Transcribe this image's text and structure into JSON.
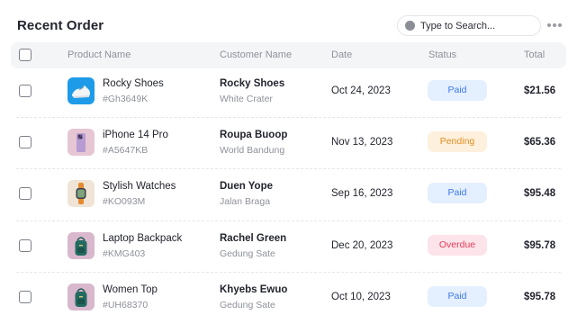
{
  "header": {
    "title": "Recent Order",
    "search_placeholder": "Type to Search..."
  },
  "columns": [
    "Product Name",
    "Customer Name",
    "Date",
    "Status",
    "Total"
  ],
  "status_colors": {
    "Paid": {
      "bg": "#e4efff",
      "fg": "#3f79ec"
    },
    "Pending": {
      "bg": "#fdf0dc",
      "fg": "#e08e22"
    },
    "Overdue": {
      "bg": "#fde4ea",
      "fg": "#e43b5a"
    }
  },
  "orders": [
    {
      "product": "Rocky Shoes",
      "sku": "#Gh3649K",
      "customer": "Rocky Shoes",
      "address": "White Crater",
      "date": "Oct 24, 2023",
      "status": "Paid",
      "total": "$21.56",
      "icon": "sneakers-thumbnail"
    },
    {
      "product": "iPhone 14 Pro",
      "sku": "#A5647KB",
      "customer": "Roupa Buoop",
      "address": "World Bandung",
      "date": "Nov 13, 2023",
      "status": "Pending",
      "total": "$65.36",
      "icon": "phone-thumbnail"
    },
    {
      "product": "Stylish Watches",
      "sku": "#KO093M",
      "customer": "Duen Yope",
      "address": "Jalan Braga",
      "date": "Sep 16, 2023",
      "status": "Paid",
      "total": "$95.48",
      "icon": "watch-thumbnail"
    },
    {
      "product": "Laptop Backpack",
      "sku": "#KMG403",
      "customer": "Rachel Green",
      "address": "Gedung Sate",
      "date": "Dec 20, 2023",
      "status": "Overdue",
      "total": "$95.78",
      "icon": "backpack-thumbnail"
    },
    {
      "product": "Women Top",
      "sku": "#UH68370",
      "customer": "Khyebs Ewuo",
      "address": "Gedung Sate",
      "date": "Oct 10, 2023",
      "status": "Paid",
      "total": "$95.78",
      "icon": "backpack-thumbnail"
    }
  ]
}
